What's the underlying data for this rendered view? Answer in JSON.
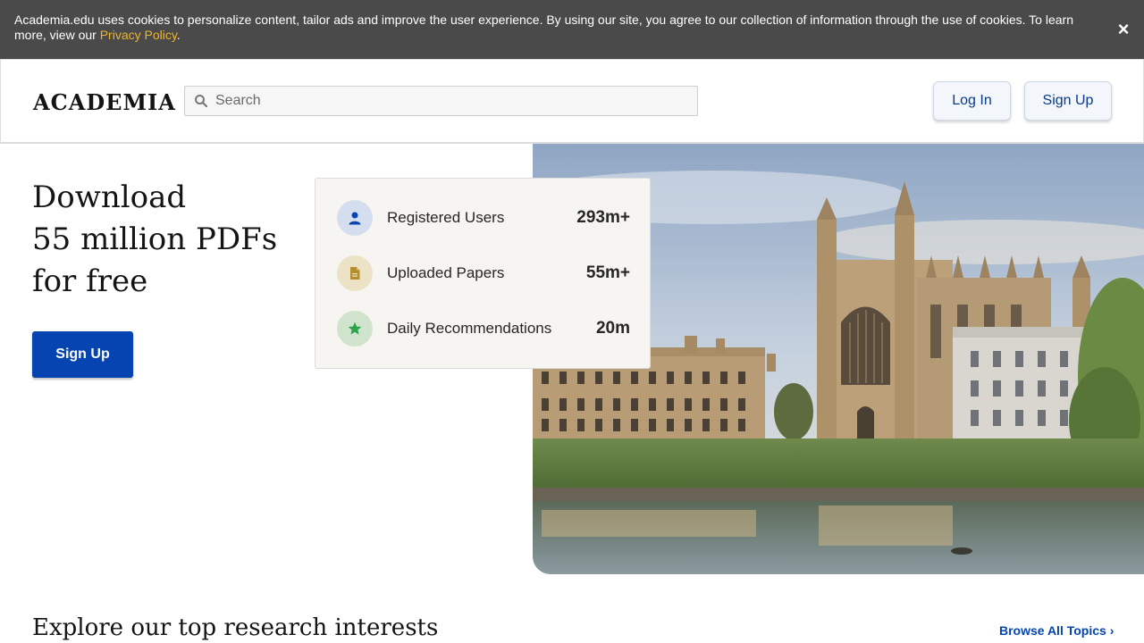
{
  "cookie_banner": {
    "text": "Academia.edu uses cookies to personalize content, tailor ads and improve the user experience. By using our site, you agree to our collection of information through the use of cookies. To learn more, view our ",
    "link": "Privacy Policy",
    "suffix": ".",
    "close": "×"
  },
  "header": {
    "logo": "ACADEMIA",
    "search_placeholder": "Search",
    "login_label": "Log In",
    "signup_label": "Sign Up"
  },
  "hero": {
    "title_lines": [
      "Download",
      "55 million PDFs",
      "for free"
    ],
    "signup_label": "Sign Up"
  },
  "stats": [
    {
      "icon": "user-icon",
      "label": "Registered Users",
      "value": "293m+",
      "icon_bg": "#d5deee",
      "icon_color": "#0645b1"
    },
    {
      "icon": "document-icon",
      "label": "Uploaded Papers",
      "value": "55m+",
      "icon_bg": "#ece3c7",
      "icon_color": "#b48e2e"
    },
    {
      "icon": "star-icon",
      "label": "Daily Recommendations",
      "value": "20m",
      "icon_bg": "#cfe3cd",
      "icon_color": "#2da34a"
    }
  ],
  "explore": {
    "title": "Explore our top research interests",
    "browse_label": "Browse All Topics"
  },
  "colors": {
    "brand_blue": "#0645b1",
    "banner_bg": "#4a4a4a",
    "banner_link": "#f0b429"
  }
}
